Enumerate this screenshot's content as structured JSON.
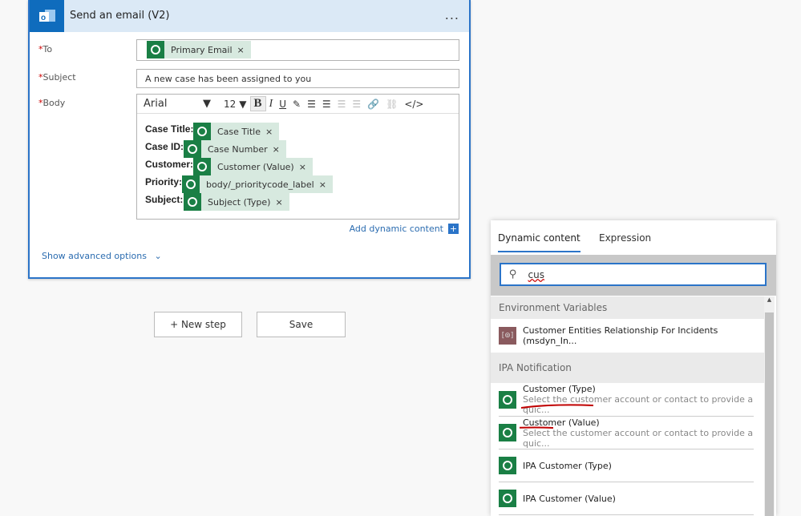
{
  "card": {
    "title": "Send an email (V2)",
    "menu": "...",
    "to_label": "To",
    "to_chip": "Primary Email",
    "subject_label": "Subject",
    "subject_value": "A new case has been assigned to you",
    "body_label": "Body",
    "toolbar": {
      "font": "Arial",
      "size": "12"
    },
    "body_lines": [
      {
        "label": "Case Title:",
        "chip": "Case Title"
      },
      {
        "label": "Case ID:",
        "chip": "Case Number"
      },
      {
        "label": "Customer:",
        "chip": "Customer (Value)"
      },
      {
        "label": "Priority:",
        "chip": "body/_prioritycode_label"
      },
      {
        "label": "Subject:",
        "chip": "Subject (Type)"
      }
    ],
    "add_dynamic": "Add dynamic content",
    "advanced": "Show advanced options"
  },
  "actions": {
    "new_step": "+ New step",
    "save": "Save"
  },
  "panel": {
    "tabs": [
      "Dynamic content",
      "Expression"
    ],
    "active_tab": "Dynamic content",
    "search_value": "cus",
    "sections": [
      {
        "title": "Environment Variables",
        "items": [
          {
            "title": "Customer Entities Relationship For Incidents (msdyn_In...",
            "icon": "environment-variable-icon"
          }
        ]
      },
      {
        "title": "IPA Notification",
        "items": [
          {
            "title": "Customer (Type)",
            "desc": "Select the customer account or contact to provide a quic..."
          },
          {
            "title": "Customer (Value)",
            "desc": "Select the customer account or contact to provide a quic..."
          },
          {
            "title": "IPA Customer (Type)"
          },
          {
            "title": "IPA Customer (Value)"
          }
        ]
      }
    ]
  },
  "colors": {
    "accent": "#0f6cbd",
    "dataverse": "#1a7f45",
    "annotation": "#c00000"
  }
}
